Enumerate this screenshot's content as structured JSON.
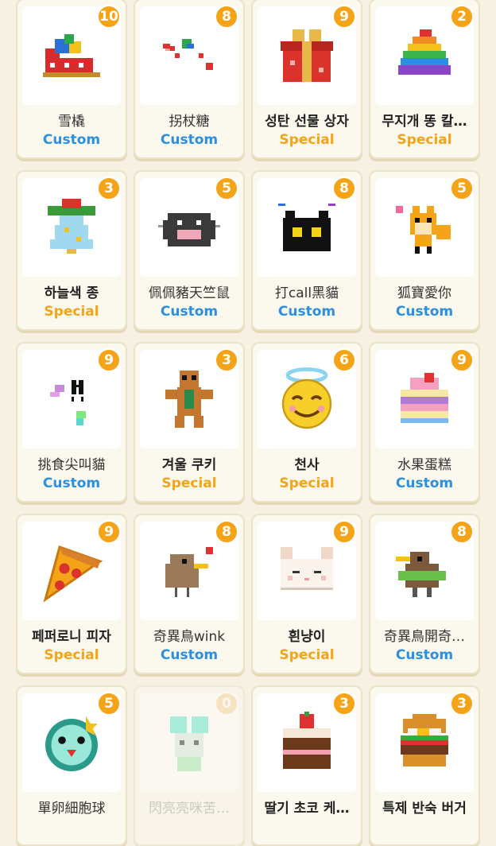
{
  "colors": {
    "custom": "#2d8fe0",
    "special": "#f5a418",
    "badge": "#f5a418"
  },
  "items": [
    {
      "name": "雪橇",
      "tag": "Custom",
      "count": "10",
      "icon": "sleigh-icon"
    },
    {
      "name": "拐杖糖",
      "tag": "Custom",
      "count": "8",
      "icon": "candy-cane-icon"
    },
    {
      "name": "성탄 선물 상자",
      "tag": "Special",
      "count": "9",
      "icon": "gift-box-icon"
    },
    {
      "name": "무지개 똥 칼…",
      "tag": "Special",
      "count": "2",
      "icon": "rainbow-poop-icon"
    },
    {
      "name": "하늘색 종",
      "tag": "Special",
      "count": "3",
      "icon": "bell-icon"
    },
    {
      "name": "佩佩豬天竺鼠",
      "tag": "Custom",
      "count": "5",
      "icon": "guinea-pig-icon"
    },
    {
      "name": "打call黑貓",
      "tag": "Custom",
      "count": "8",
      "icon": "black-cat-icon"
    },
    {
      "name": "狐寶愛你",
      "tag": "Custom",
      "count": "5",
      "icon": "fox-icon"
    },
    {
      "name": "挑食尖叫貓",
      "tag": "Custom",
      "count": "9",
      "icon": "screaming-cat-icon"
    },
    {
      "name": "겨울 쿠키",
      "tag": "Special",
      "count": "3",
      "icon": "gingerbread-icon"
    },
    {
      "name": "천사",
      "tag": "Special",
      "count": "6",
      "icon": "angel-emoji-icon"
    },
    {
      "name": "水果蛋糕",
      "tag": "Custom",
      "count": "9",
      "icon": "fruit-cake-icon"
    },
    {
      "name": "페퍼로니 피자",
      "tag": "Special",
      "count": "9",
      "icon": "pizza-icon"
    },
    {
      "name": "奇異鳥wink",
      "tag": "Custom",
      "count": "8",
      "icon": "kiwi-bird-icon"
    },
    {
      "name": "흰냥이",
      "tag": "Special",
      "count": "9",
      "icon": "white-cat-icon"
    },
    {
      "name": "奇異鳥開奇…",
      "tag": "Custom",
      "count": "8",
      "icon": "kiwi-ring-icon"
    },
    {
      "name": "單卵細胞球",
      "tag": "",
      "count": "5",
      "icon": "cell-ball-icon"
    },
    {
      "name": "閃亮亮咪苦…",
      "tag": "",
      "count": "0",
      "icon": "shiny-mouse-icon"
    },
    {
      "name": "딸기 초코 케…",
      "tag": "",
      "count": "3",
      "icon": "choco-cake-icon"
    },
    {
      "name": "특제 반숙 버거",
      "tag": "",
      "count": "3",
      "icon": "burger-icon"
    }
  ]
}
